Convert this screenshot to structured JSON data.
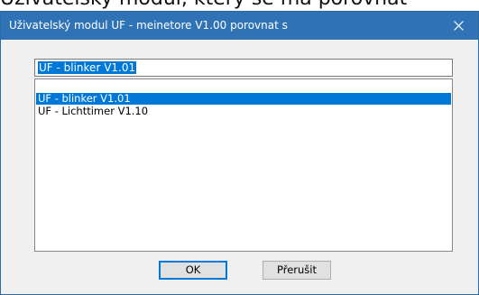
{
  "background_text": "Uživatelský modul, který se má porovnat",
  "window": {
    "title": "Uživatelský modul UF - meinetore V1.00 porovnat s"
  },
  "search": {
    "value": "UF - blinker V1.01"
  },
  "list": {
    "items": [
      {
        "label": "UF - blinker V1.01",
        "selected": true
      },
      {
        "label": "UF - Lichttimer V1.10",
        "selected": false
      }
    ]
  },
  "buttons": {
    "ok_label": "OK",
    "cancel_label": "Přerušit"
  },
  "colors": {
    "titlebar": "#2f73b6",
    "selection": "#0078d7",
    "dialog_bg": "#f0f0f0"
  },
  "icons": {
    "close": "close-icon"
  }
}
